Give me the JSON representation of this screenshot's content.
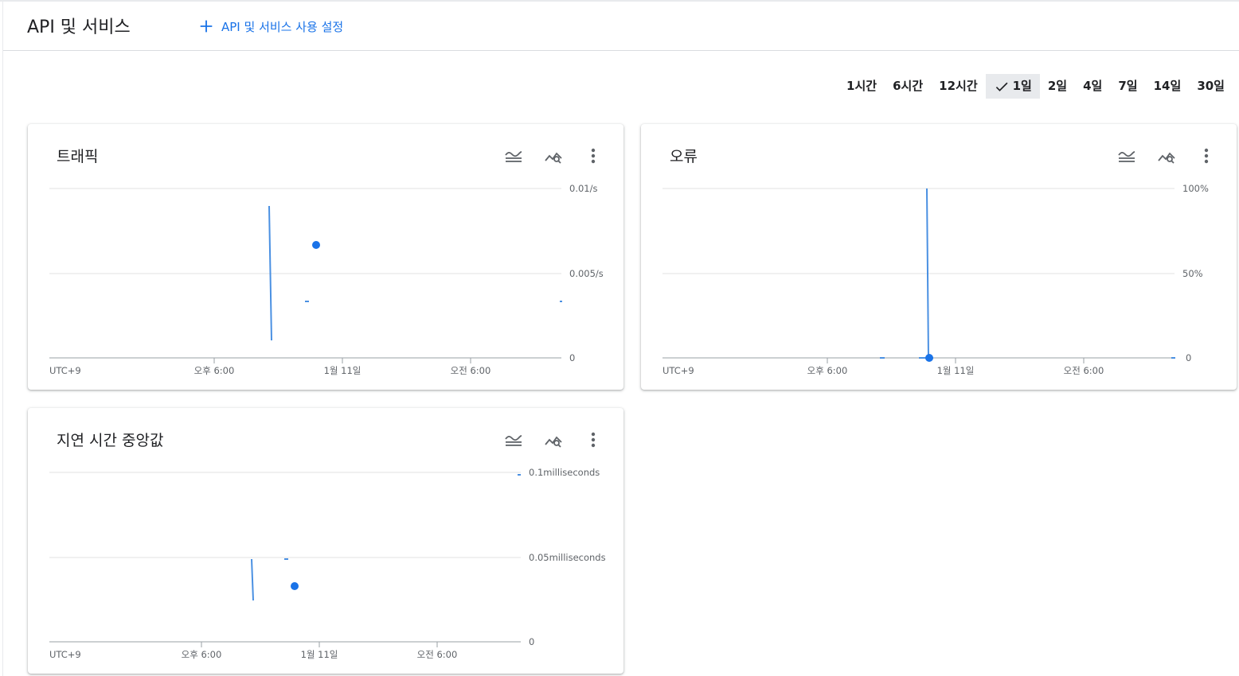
{
  "header": {
    "title": "API 및 서비스",
    "enable_label": "API 및 서비스 사용 설정"
  },
  "time_range": {
    "options": [
      "1시간",
      "6시간",
      "12시간",
      "1일",
      "2일",
      "4일",
      "7일",
      "14일",
      "30일"
    ],
    "selected": "1일"
  },
  "icons": {
    "plus": "plus-icon",
    "check": "check-icon",
    "legend": "legend-toggle-icon",
    "explore": "query-stats-icon",
    "more": "more-vert-icon"
  },
  "colors": {
    "accent": "#1a73e8",
    "series": "#4a90e2",
    "point": "#1a73e8",
    "grid": "#e0e0e0",
    "axis": "#9aa0a6"
  },
  "chart_data": [
    {
      "type": "line",
      "title": "트래픽",
      "y_tick_labels": [
        "0.01/s",
        "0.005/s",
        "0"
      ],
      "x_tick_labels": [
        "UTC+9",
        "오후 6:00",
        "1월 11일",
        "오전 6:00"
      ],
      "grid": true
    },
    {
      "type": "line",
      "title": "오류",
      "y_tick_labels": [
        "100%",
        "50%",
        "0"
      ],
      "x_tick_labels": [
        "UTC+9",
        "오후 6:00",
        "1월 11일",
        "오전 6:00"
      ],
      "grid": true
    },
    {
      "type": "line",
      "title": "지연 시간 중앙값",
      "y_tick_labels": [
        "0.1milliseconds",
        "0.05milliseconds",
        "0"
      ],
      "x_tick_labels": [
        "UTC+9",
        "오후 6:00",
        "1월 11일",
        "오전 6:00"
      ],
      "grid": true
    }
  ]
}
